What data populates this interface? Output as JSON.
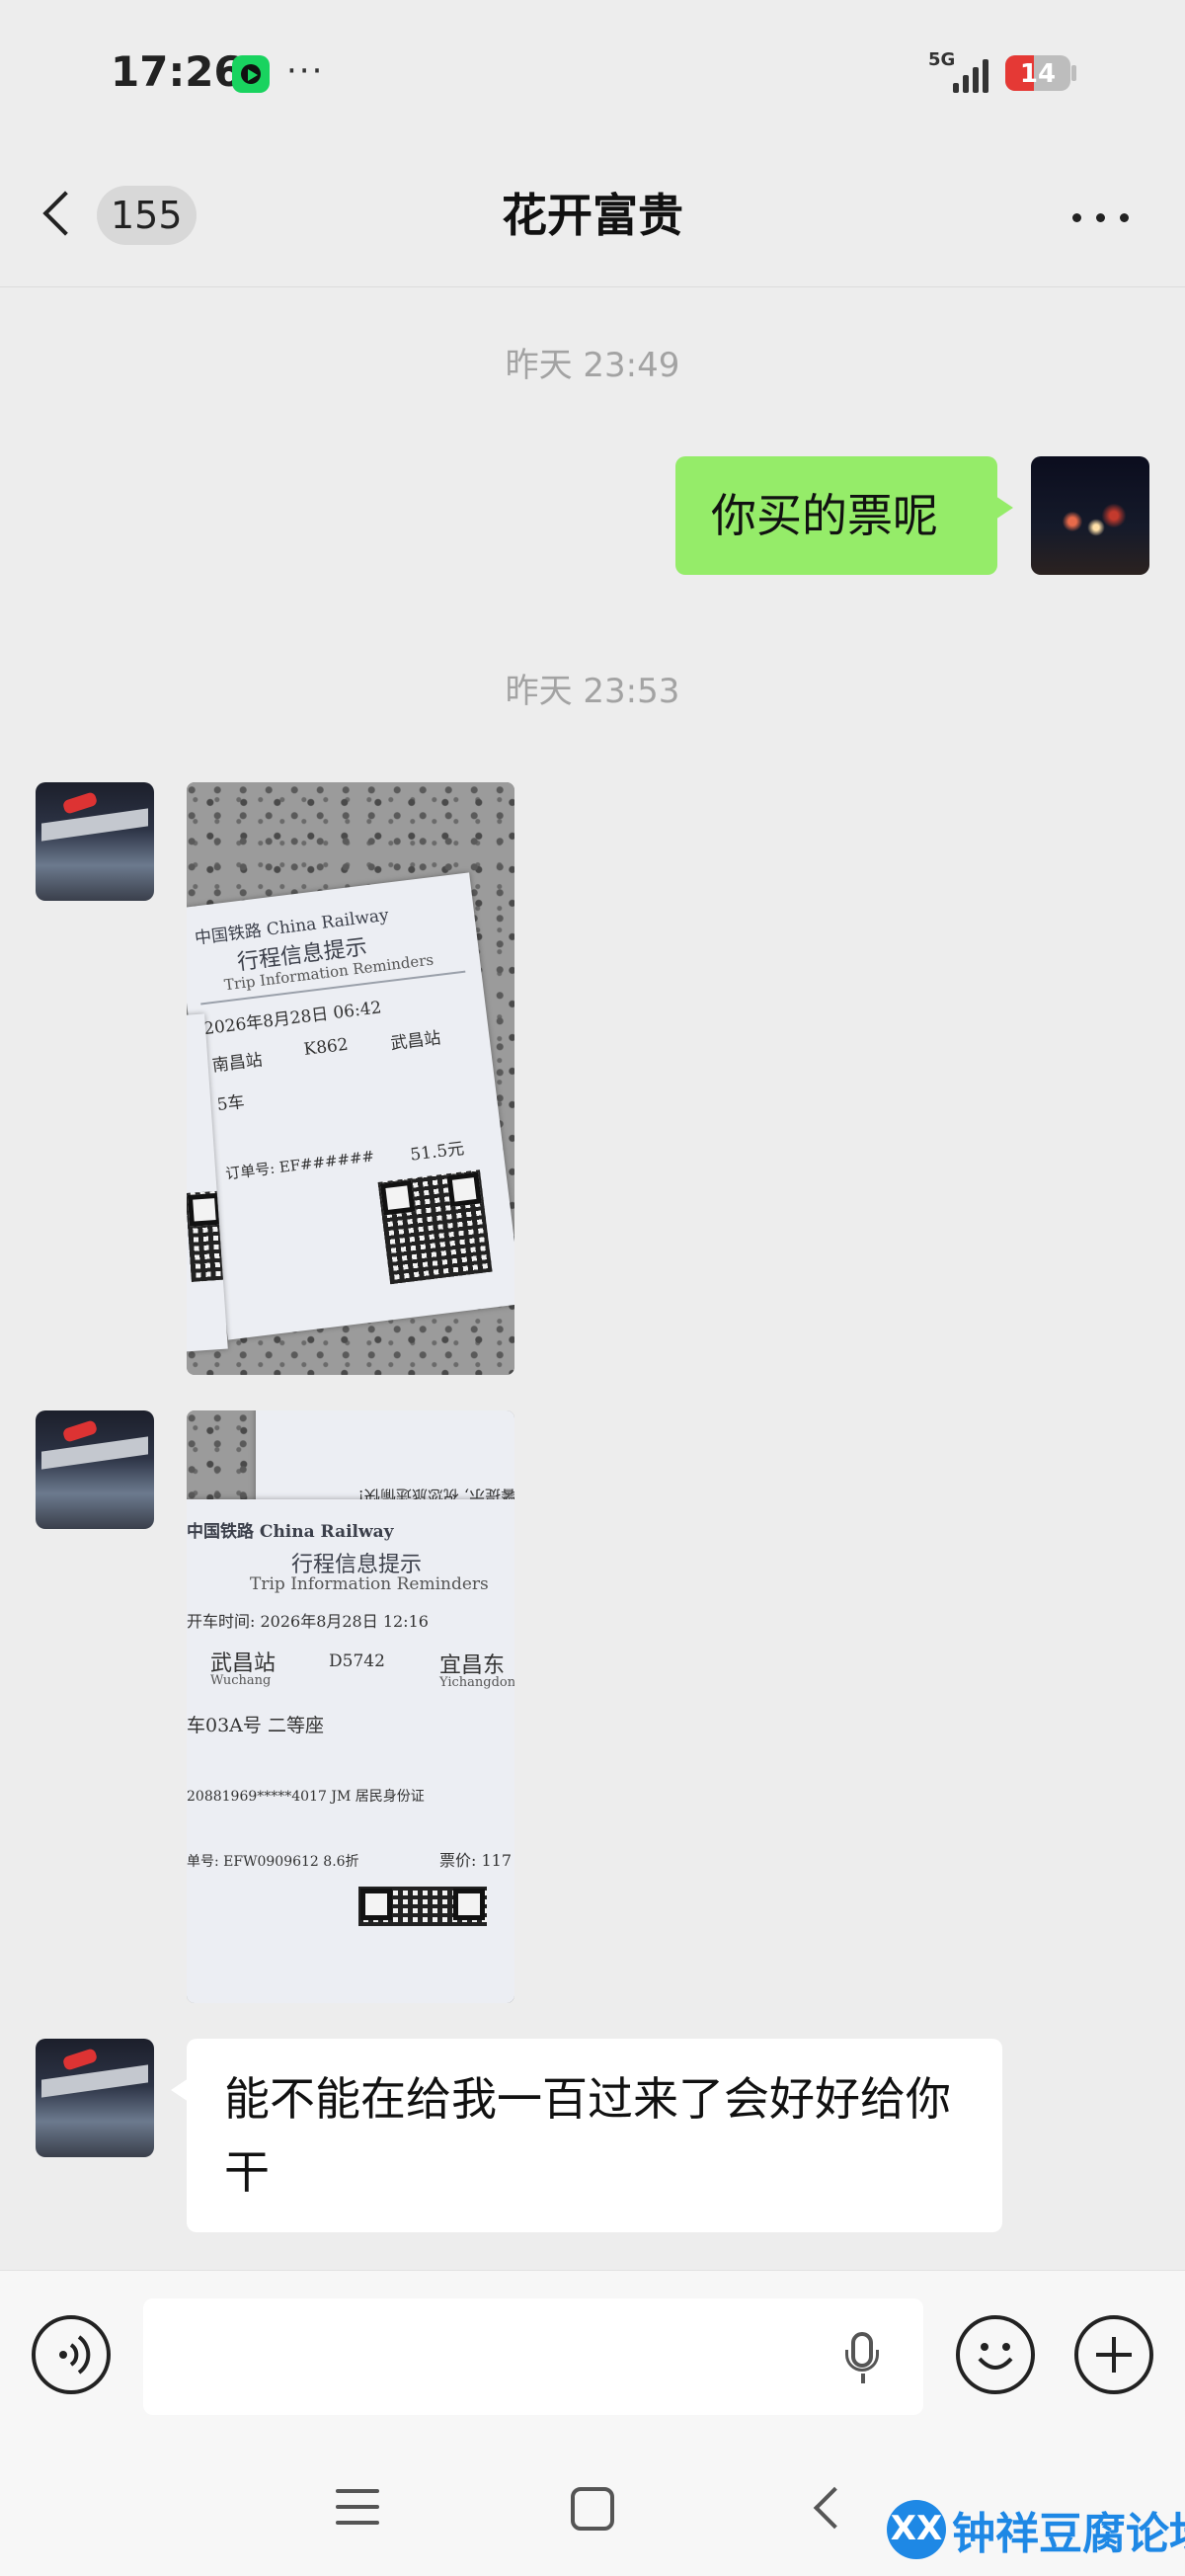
{
  "status_bar": {
    "time": "17:26",
    "dots": "···",
    "network": "5G",
    "battery_level": "14"
  },
  "header": {
    "unread_count": "155",
    "title": "花开富贵"
  },
  "messages": {
    "timestamp_1": "昨天 23:49",
    "outgoing_1": "你买的票呢",
    "timestamp_2": "昨天 23:53",
    "incoming_text": "能不能在给我一百过来了会好好给你干"
  },
  "ticket_1": {
    "brand": "中国铁路 China Railway",
    "title": "行程信息提示",
    "subtitle": "Trip Information Reminders",
    "date_time": "2026年8月28日 06:42",
    "from": "南昌站",
    "train": "K862",
    "to": "武昌站",
    "seat": "5车",
    "price": "51.5元",
    "order": "订单号: EF######"
  },
  "ticket_2": {
    "brand": "中国铁路 China Railway",
    "title": "行程信息提示",
    "subtitle": "Trip Information Reminders",
    "date_time": "开车时间: 2026年8月28日 12:16",
    "from": "武昌站",
    "from_pinyin": "Wuchang",
    "train": "D5742",
    "to": "宜昌东",
    "to_pinyin": "Yichangdong",
    "seat": "车03A号 二等座",
    "id_line": "20881969*****4017 JM 居民身份证",
    "order": "单号: EFW0909612 8.6折",
    "price": "票价: 117",
    "flipped_note": "温馨提示, 祝您旅途愉快!"
  },
  "input": {
    "placeholder": ""
  },
  "watermark": {
    "logo": "XX",
    "text": "钟祥豆腐论坛"
  },
  "colors": {
    "outgoing_bubble": "#95ec69",
    "incoming_bubble": "#ffffff",
    "background": "#ededed",
    "battery_alert": "#e53935",
    "watermark": "#1e88e5"
  }
}
